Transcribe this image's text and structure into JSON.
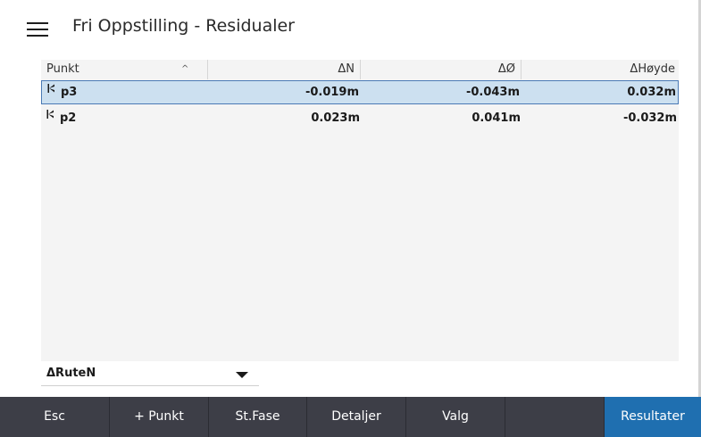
{
  "header": {
    "title": "Fri Oppstilling - Residualer"
  },
  "table": {
    "columns": {
      "punkt": "Punkt",
      "dn": "ΔN",
      "de": "ΔØ",
      "dh": "ΔHøyde"
    },
    "rows": [
      {
        "name": "p3",
        "dn": "-0.019m",
        "de": "-0.043m",
        "dh": "0.032m",
        "selected": true
      },
      {
        "name": "p2",
        "dn": "0.023m",
        "de": "0.041m",
        "dh": "-0.032m",
        "selected": false
      }
    ]
  },
  "dropdown": {
    "value": "ΔRuteN"
  },
  "toolbar": {
    "esc": "Esc",
    "add_point": "+ Punkt",
    "st_fase": "St.Fase",
    "details": "Detaljer",
    "options": "Valg",
    "results": "Resultater"
  },
  "colors": {
    "accent": "#1f6fb0",
    "toolbar_bg": "#3d3e47",
    "selection": "#cce0f0"
  }
}
